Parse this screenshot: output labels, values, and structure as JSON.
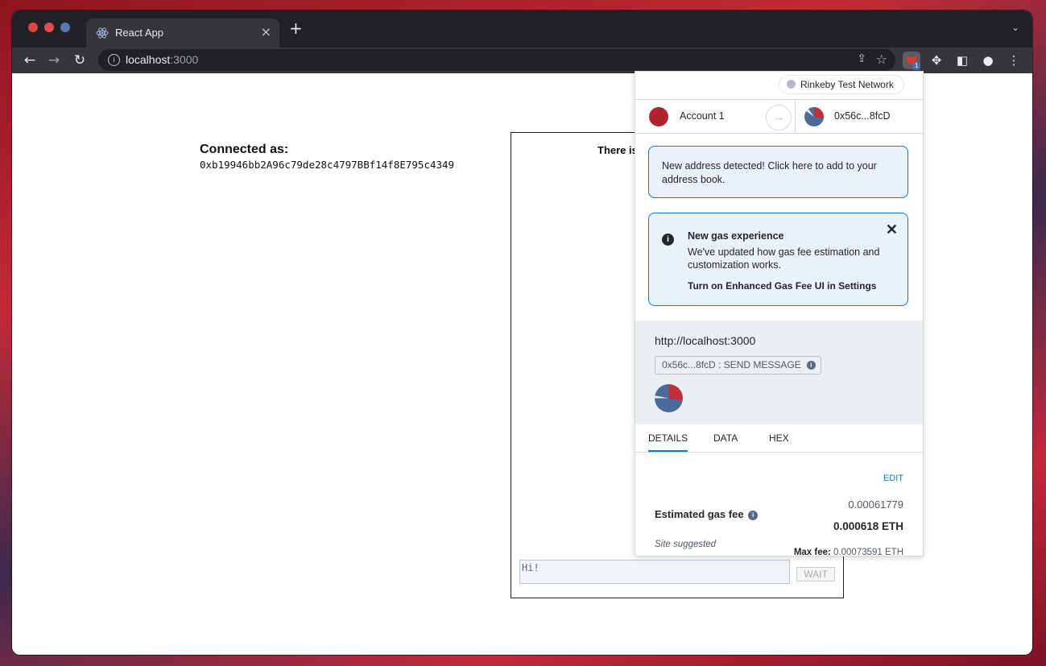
{
  "browser": {
    "tab_title": "React App",
    "tab_close": "×",
    "new_tab": "+",
    "tab_menu": "⌄",
    "url_host": "localhost",
    "url_port": ":3000",
    "info_glyph": "i",
    "extension_badge": "1"
  },
  "page": {
    "connected_title": "Connected as:",
    "connected_address": "0xb19946bb2A96c79de28c4797BBf14f8E795c4349",
    "chat_header": "There is",
    "message_input_value": "Hi!",
    "send_button": "WAIT"
  },
  "metamask": {
    "network": "Rinkeby Test Network",
    "from_account": "Account 1",
    "to_account": "0x56c...8fcD",
    "notice": "New address detected! Click here to add to your address book.",
    "gas_title": "New gas experience",
    "gas_body": "We've updated how gas fee estimation and customization works.",
    "gas_link": "Turn on Enhanced Gas Fee UI in Settings",
    "gas_close": "✕",
    "origin": "http://localhost:3000",
    "action_chip": "0x56c...8fcD : SEND MESSAGE",
    "tabs": [
      "DETAILS",
      "DATA",
      "HEX"
    ],
    "edit": "EDIT",
    "fee_label": "Estimated gas fee",
    "fee_secondary": "0.00061779",
    "fee_primary": "0.000618 ETH",
    "site_suggested": "Site suggested",
    "max_fee_label": "Max fee:",
    "max_fee_value": "0.00073591 ETH"
  },
  "colors": {
    "accent": "#037dd6",
    "notice_bg": "#eaf1fa",
    "chrome_dark": "#202124"
  }
}
